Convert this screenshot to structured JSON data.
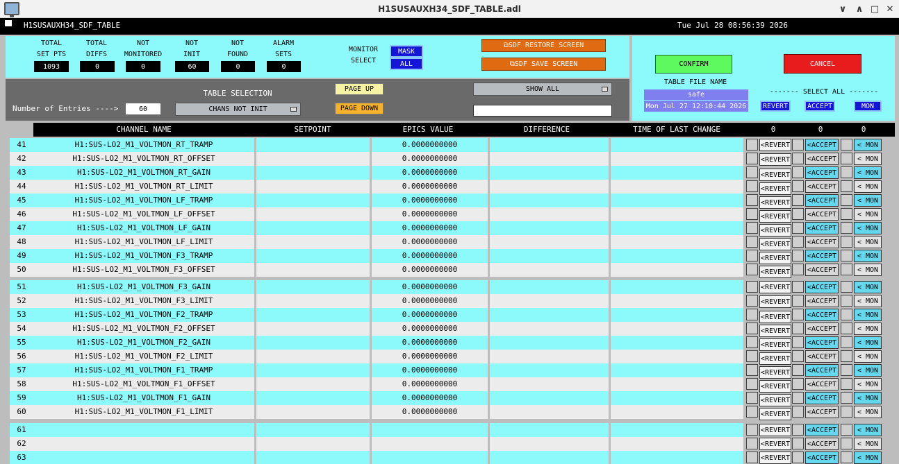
{
  "window": {
    "title": "H1SUSAUXH34_SDF_TABLE.adl",
    "controls": [
      "∨",
      "∧",
      "□",
      "✕"
    ]
  },
  "header": {
    "screen_name": "H1SUSAUXH34_SDF_TABLE",
    "datetime": "Tue Jul 28 08:56:39 2026"
  },
  "counters": [
    {
      "label1": "TOTAL",
      "label2": "SET PTS",
      "value": "1093"
    },
    {
      "label1": "TOTAL",
      "label2": "DIFFS",
      "value": "0"
    },
    {
      "label1": "NOT",
      "label2": "MONITORED",
      "value": "0"
    },
    {
      "label1": "NOT",
      "label2": "INIT",
      "value": "60"
    },
    {
      "label1": "NOT",
      "label2": "FOUND",
      "value": "0"
    },
    {
      "label1": "ALARM",
      "label2": "SETS",
      "value": "0"
    }
  ],
  "monitor_select": {
    "label1": "MONITOR",
    "label2": "SELECT",
    "mask": "MASK",
    "all": "ALL"
  },
  "sdf": {
    "restore": "⧉SDF RESTORE SCREEN",
    "save": "⧉SDF SAVE SCREEN"
  },
  "confirm": "CONFIRM",
  "cancel": "CANCEL",
  "table_file": {
    "label": "TABLE FILE NAME",
    "name": "safe",
    "date": "Mon Jul 27 12:10:44 2026"
  },
  "select_all": {
    "label": "------- SELECT ALL -------",
    "revert": "REVERT",
    "accept": "ACCEPT",
    "mon": "MON"
  },
  "controls": {
    "entries_label": "Number of Entries ---->",
    "entries_value": "60",
    "table_selection_label": "TABLE SELECTION",
    "table_selection_value": "CHANS NOT INIT",
    "page_up": "PAGE UP",
    "page_down": "PAGE DOWN",
    "show_all": "SHOW ALL",
    "filter_value": ""
  },
  "columns": {
    "channel": "CHANNEL NAME",
    "setpoint": "SETPOINT",
    "epics": "EPICS VALUE",
    "difference": "DIFFERENCE",
    "time": "TIME OF LAST CHANGE",
    "count_revert": "0",
    "count_accept": "0",
    "count_mon": "0"
  },
  "row_buttons": {
    "revert": "<REVERT",
    "accept": "<ACCEPT",
    "mon": "< MON"
  },
  "rows": [
    {
      "num": "41",
      "channel": "H1:SUS-LO2_M1_VOLTMON_RT_TRAMP",
      "setpoint": "",
      "epics": "0.0000000000",
      "difference": "",
      "time": ""
    },
    {
      "num": "42",
      "channel": "H1:SUS-LO2_M1_VOLTMON_RT_OFFSET",
      "setpoint": "",
      "epics": "0.0000000000",
      "difference": "",
      "time": ""
    },
    {
      "num": "43",
      "channel": "H1:SUS-LO2_M1_VOLTMON_RT_GAIN",
      "setpoint": "",
      "epics": "0.0000000000",
      "difference": "",
      "time": ""
    },
    {
      "num": "44",
      "channel": "H1:SUS-LO2_M1_VOLTMON_RT_LIMIT",
      "setpoint": "",
      "epics": "0.0000000000",
      "difference": "",
      "time": ""
    },
    {
      "num": "45",
      "channel": "H1:SUS-LO2_M1_VOLTMON_LF_TRAMP",
      "setpoint": "",
      "epics": "0.0000000000",
      "difference": "",
      "time": ""
    },
    {
      "num": "46",
      "channel": "H1:SUS-LO2_M1_VOLTMON_LF_OFFSET",
      "setpoint": "",
      "epics": "0.0000000000",
      "difference": "",
      "time": ""
    },
    {
      "num": "47",
      "channel": "H1:SUS-LO2_M1_VOLTMON_LF_GAIN",
      "setpoint": "",
      "epics": "0.0000000000",
      "difference": "",
      "time": ""
    },
    {
      "num": "48",
      "channel": "H1:SUS-LO2_M1_VOLTMON_LF_LIMIT",
      "setpoint": "",
      "epics": "0.0000000000",
      "difference": "",
      "time": ""
    },
    {
      "num": "49",
      "channel": "H1:SUS-LO2_M1_VOLTMON_F3_TRAMP",
      "setpoint": "",
      "epics": "0.0000000000",
      "difference": "",
      "time": ""
    },
    {
      "num": "50",
      "channel": "H1:SUS-LO2_M1_VOLTMON_F3_OFFSET",
      "setpoint": "",
      "epics": "0.0000000000",
      "difference": "",
      "time": ""
    },
    {
      "num": "51",
      "channel": "H1:SUS-LO2_M1_VOLTMON_F3_GAIN",
      "setpoint": "",
      "epics": "0.0000000000",
      "difference": "",
      "time": ""
    },
    {
      "num": "52",
      "channel": "H1:SUS-LO2_M1_VOLTMON_F3_LIMIT",
      "setpoint": "",
      "epics": "0.0000000000",
      "difference": "",
      "time": ""
    },
    {
      "num": "53",
      "channel": "H1:SUS-LO2_M1_VOLTMON_F2_TRAMP",
      "setpoint": "",
      "epics": "0.0000000000",
      "difference": "",
      "time": ""
    },
    {
      "num": "54",
      "channel": "H1:SUS-LO2_M1_VOLTMON_F2_OFFSET",
      "setpoint": "",
      "epics": "0.0000000000",
      "difference": "",
      "time": ""
    },
    {
      "num": "55",
      "channel": "H1:SUS-LO2_M1_VOLTMON_F2_GAIN",
      "setpoint": "",
      "epics": "0.0000000000",
      "difference": "",
      "time": ""
    },
    {
      "num": "56",
      "channel": "H1:SUS-LO2_M1_VOLTMON_F2_LIMIT",
      "setpoint": "",
      "epics": "0.0000000000",
      "difference": "",
      "time": ""
    },
    {
      "num": "57",
      "channel": "H1:SUS-LO2_M1_VOLTMON_F1_TRAMP",
      "setpoint": "",
      "epics": "0.0000000000",
      "difference": "",
      "time": ""
    },
    {
      "num": "58",
      "channel": "H1:SUS-LO2_M1_VOLTMON_F1_OFFSET",
      "setpoint": "",
      "epics": "0.0000000000",
      "difference": "",
      "time": ""
    },
    {
      "num": "59",
      "channel": "H1:SUS-LO2_M1_VOLTMON_F1_GAIN",
      "setpoint": "",
      "epics": "0.0000000000",
      "difference": "",
      "time": ""
    },
    {
      "num": "60",
      "channel": "H1:SUS-LO2_M1_VOLTMON_F1_LIMIT",
      "setpoint": "",
      "epics": "0.0000000000",
      "difference": "",
      "time": ""
    },
    {
      "num": "61",
      "channel": "",
      "setpoint": "",
      "epics": "",
      "difference": "",
      "time": ""
    },
    {
      "num": "62",
      "channel": "",
      "setpoint": "",
      "epics": "",
      "difference": "",
      "time": ""
    },
    {
      "num": "63",
      "channel": "",
      "setpoint": "",
      "epics": "",
      "difference": "",
      "time": ""
    }
  ],
  "colors": {
    "cyan": "#8cf9fb",
    "row_alt": "#ececec",
    "panel_gray": "#6a6a6a",
    "orange": "#e06a12",
    "blue": "#1515d8",
    "green": "#5ef95e",
    "red": "#e81c1c"
  }
}
